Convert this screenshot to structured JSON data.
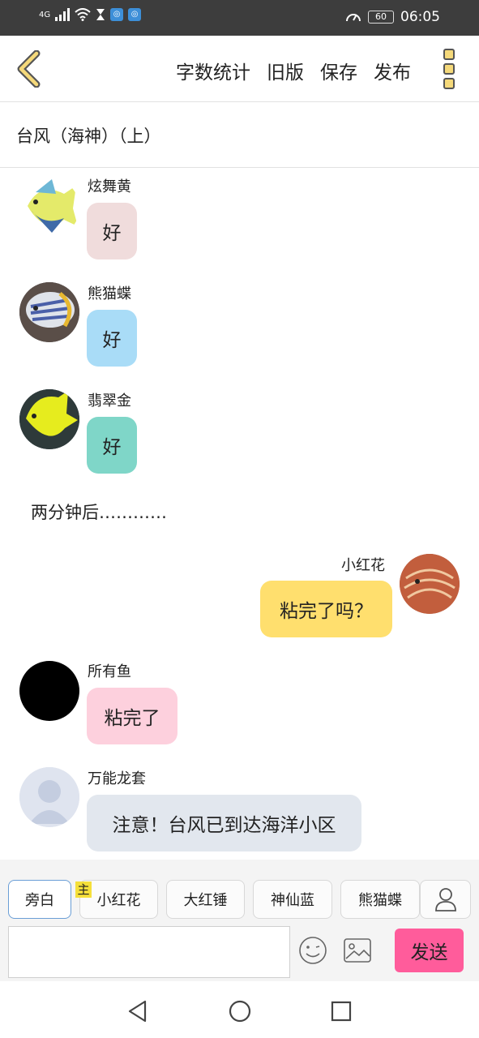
{
  "status_bar": {
    "network": "4G",
    "battery": "60",
    "time": "06:05"
  },
  "toolbar": {
    "word_count": "字数统计",
    "old_version": "旧版",
    "save": "保存",
    "publish": "发布"
  },
  "story_title": "台风（海神）（上）",
  "messages": [
    {
      "name": "炫舞黄",
      "text": "好",
      "bubble_color": "#f0dcdc"
    },
    {
      "name": "熊猫蝶",
      "text": "好",
      "bubble_color": "#a9dcf7"
    },
    {
      "name": "翡翠金",
      "text": "好",
      "bubble_color": "#7fd6c8"
    },
    {
      "narration": "两分钟后…………"
    },
    {
      "name": "小红花",
      "text": "粘完了吗？",
      "bubble_color": "#ffdf6e"
    },
    {
      "name": "所有鱼",
      "text": "粘完了",
      "bubble_color": "#fdd0dd"
    },
    {
      "name": "万能龙套",
      "text": "注意！台风已到达海洋小区",
      "bubble_color": "#e2e7ee"
    }
  ],
  "character_chips": [
    "旁白",
    "小红花",
    "大红锤",
    "神仙蓝",
    "熊猫蝶"
  ],
  "main_tag": "主",
  "composer": {
    "input_value": "",
    "send_label": "发送"
  },
  "colors": {
    "send_button": "#ff5c9b",
    "status_bar": "#3d3d3d",
    "active_chip_border": "#6a9ed6"
  }
}
